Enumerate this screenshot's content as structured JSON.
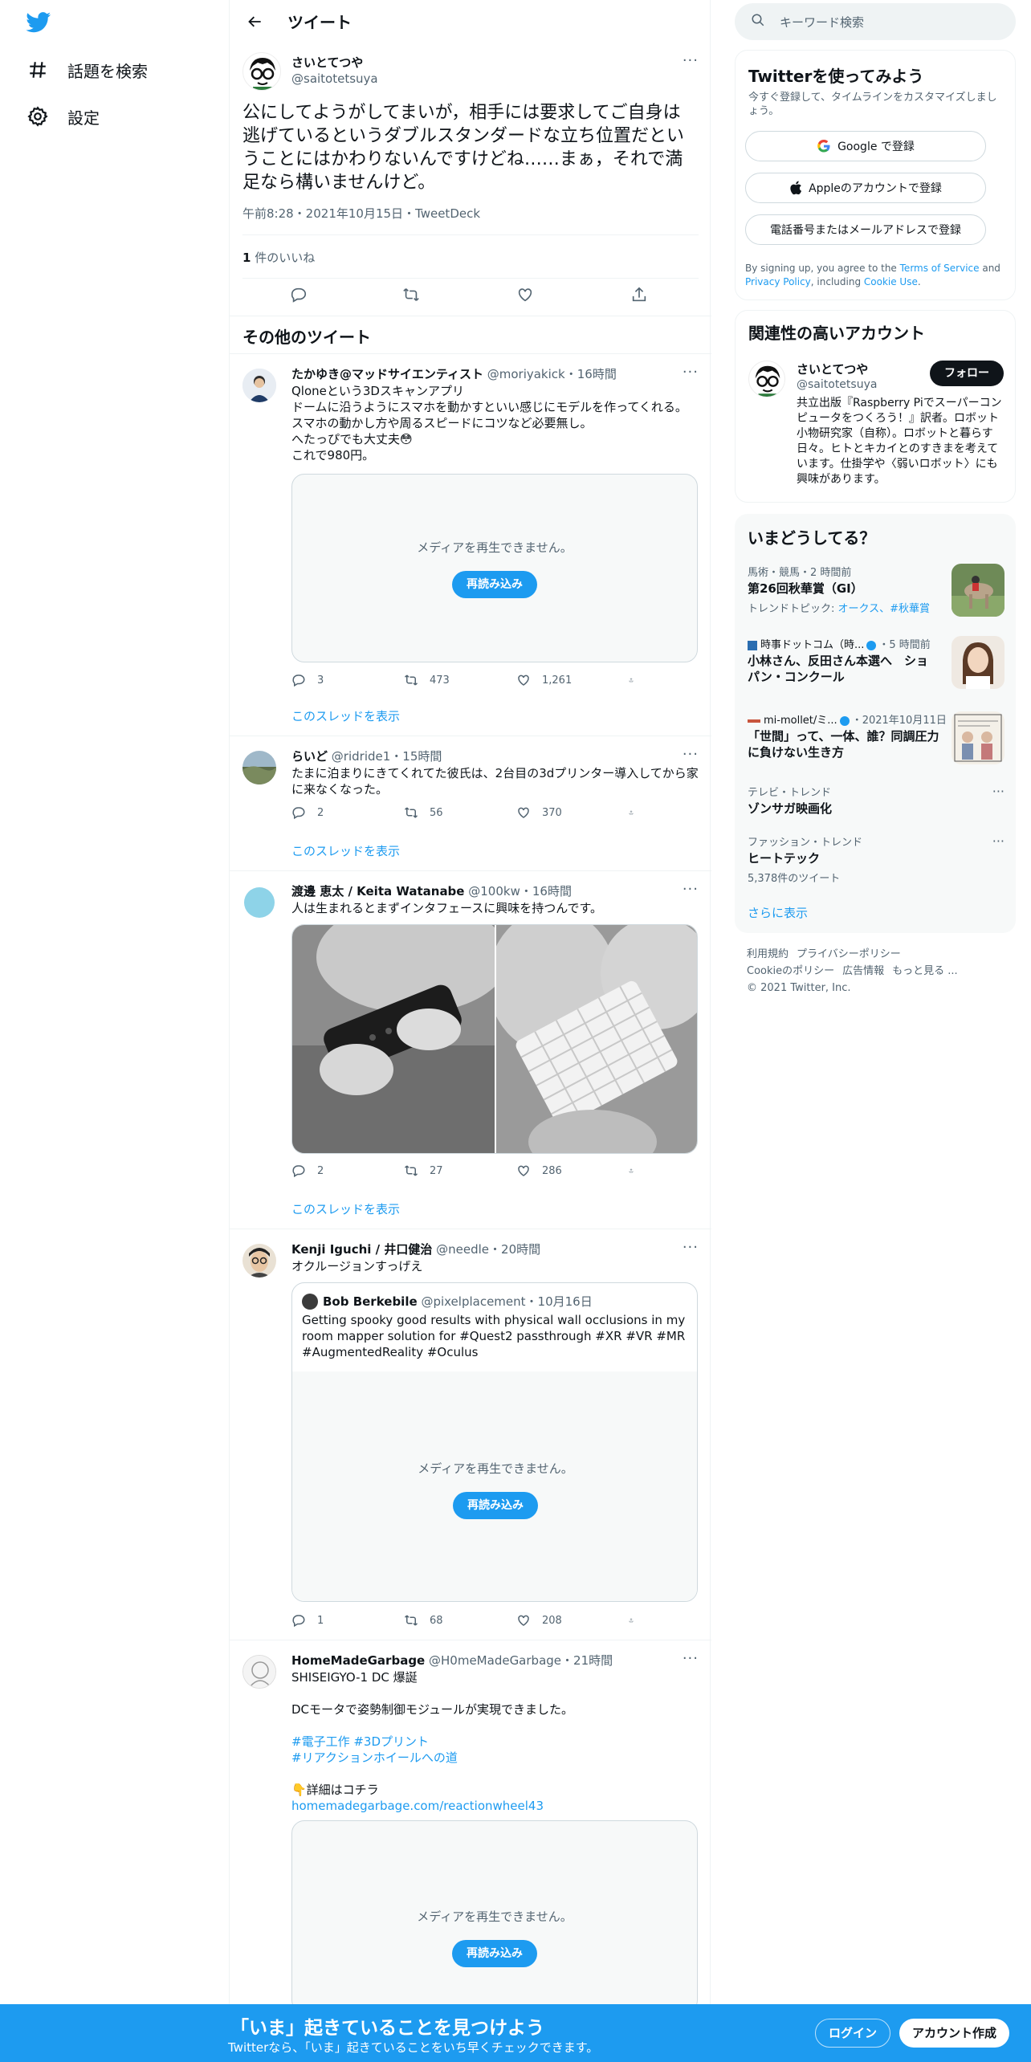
{
  "colors": {
    "accent": "#1d9bf0",
    "text": "#0f1419",
    "muted": "#536471",
    "border": "#eff3f4"
  },
  "nav": {
    "logo_icon": "twitter-bird-icon",
    "explore": "話題を検索",
    "settings": "設定"
  },
  "header": {
    "title": "ツイート"
  },
  "focal": {
    "name": "さいとてつや",
    "handle": "@saitotetsuya",
    "text": "公にしてようがしてまいが，相手には要求してご自身は逃げているというダブルスタンダードな立ち位置だということにはかわりないんですけどね……まぁ，それで満足なら構いませんけど。",
    "meta": "午前8:28・2021年10月15日・TweetDeck",
    "likes_count": "1",
    "likes_label": " 件のいいね"
  },
  "more_tweets_title": "その他のツイート",
  "media_unavailable": "メディアを再生できません。",
  "reload_label": "再読み込み",
  "thread_link": "このスレッドを表示",
  "tweets": [
    {
      "name": "たかゆき@マッドサイエンティスト",
      "handle": "@moriyakick",
      "time": "16時間",
      "lines": [
        "Qloneという3Dスキャンアプリ",
        "ドームに沿うようにスマホを動かすといい感じにモデルを作ってくれる。",
        "スマホの動かし方や周るスピードにコツなど必要無し。",
        "へたっぴでも大丈夫😳",
        "これで980円。"
      ],
      "replies": "3",
      "retweets": "473",
      "likes": "1,261"
    },
    {
      "name": "らいど",
      "handle": "@ridride1",
      "time": "15時間",
      "lines": [
        "たまに泊まりにきてくれてた彼氏は、2台目の3dプリンター導入してから家に来なくなった。"
      ],
      "replies": "2",
      "retweets": "56",
      "likes": "370"
    },
    {
      "name": "渡邊 恵太 / Keita Watanabe",
      "handle": "@100kw",
      "time": "16時間",
      "lines": [
        "人は生まれるとまずインタフェースに興味を持つんです。"
      ],
      "replies": "2",
      "retweets": "27",
      "likes": "286"
    },
    {
      "name": "Kenji Iguchi / 井口健治",
      "handle": "@needle",
      "time": "20時間",
      "lines": [
        "オクルージョンすっげえ"
      ],
      "quote": {
        "name": "Bob Berkebile",
        "handle": "@pixelplacement",
        "time": "10月16日",
        "text": "Getting spooky good results with physical wall occlusions in my room mapper solution for #Quest2 passthrough #XR #VR #MR #AugmentedReality #Oculus"
      },
      "replies": "1",
      "retweets": "68",
      "likes": "208"
    },
    {
      "name": "HomeMadeGarbage",
      "handle": "@H0meMadeGarbage",
      "time": "21時間",
      "line1": "SHISEIGYO-1 DC 爆誕",
      "line2": "DCモータで姿勢制御モジュールが実現できました。",
      "tags1": "#電子工作 #3Dプリント",
      "tags2": "#リアクションホイールへの道",
      "detail": "👇詳細はコチラ",
      "link": "homemadegarbage.com/reactionwheel43"
    }
  ],
  "search": {
    "placeholder": "キーワード検索"
  },
  "signup": {
    "title": "Twitterを使ってみよう",
    "subtitle": "今すぐ登録して、タイムラインをカスタマイズしましょう。",
    "google": "Google で登録",
    "apple": "Appleのアカウントで登録",
    "phone": "電話番号またはメールアドレスで登録",
    "terms_pre": "By signing up, you agree to the ",
    "terms_link": "Terms of Service",
    "terms_and": " and ",
    "privacy_link": "Privacy Policy",
    "terms_mid": ", including ",
    "cookie_link": "Cookie Use",
    "terms_end": "."
  },
  "related": {
    "title": "関連性の高いアカウント",
    "name": "さいとてつや",
    "handle": "@saitotetsuya",
    "follow": "フォロー",
    "bio": "共立出版『Raspberry Piでスーパーコンピュータをつくろう！』訳者。ロボット小物研究家（自称）。ロボットと暮らす日々。ヒトとキカイとのすきまを考えています。仕掛学や〈弱いロボット〉にも興味があります。"
  },
  "trends": {
    "title": "いまどうしてる？",
    "items": [
      {
        "ctx": "馬術・競馬・2 時間前",
        "title": "第26回秋華賞（GI）",
        "sub_pre": "トレンドトピック: ",
        "sub_links": "オークス、#秋華賞"
      },
      {
        "ctx_source": "時事ドットコム（時...",
        "ctx_time": "・5 時間前",
        "title": "小林さん、反田さん本選へ　ショパン・コンクール"
      },
      {
        "ctx_source": "mi-mollet/ミ...",
        "ctx_time": "・2021年10月11日",
        "title": "「世間」って、一体、誰？同調圧力に負けない生き方"
      },
      {
        "ctx": "テレビ・トレンド",
        "title": "ゾンサガ映画化"
      },
      {
        "ctx": "ファッション・トレンド",
        "title": "ヒートテック",
        "sub": "5,378件のツイート"
      }
    ],
    "more": "さらに表示"
  },
  "footer": {
    "line1": [
      "利用規約",
      "プライバシーポリシー"
    ],
    "line2": [
      "Cookieのポリシー",
      "広告情報",
      "もっと見る ..."
    ],
    "copyright": "© 2021 Twitter, Inc."
  },
  "bottom": {
    "headline": "「いま」起きていることを見つけよう",
    "sub": "Twitterなら、「いま」起きていることをいち早くチェックできます。",
    "login": "ログイン",
    "signup": "アカウント作成"
  }
}
